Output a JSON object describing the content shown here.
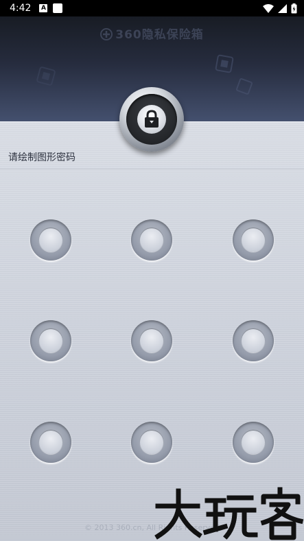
{
  "status_bar": {
    "time": "4:42",
    "notification_icon_letter": "A",
    "icons": [
      "a-notification-icon",
      "square-notification-icon",
      "wifi-icon",
      "signal-icon",
      "battery-icon"
    ]
  },
  "header": {
    "brand_text": "360隐私保险箱",
    "brand_icon": "plus-circle-icon"
  },
  "main": {
    "lock_icon": "padlock-icon",
    "hint_text": "请绘制图形密码",
    "pattern_dots": [
      {
        "row": 1,
        "col": 1
      },
      {
        "row": 1,
        "col": 2
      },
      {
        "row": 1,
        "col": 3
      },
      {
        "row": 2,
        "col": 1
      },
      {
        "row": 2,
        "col": 2
      },
      {
        "row": 2,
        "col": 3
      },
      {
        "row": 3,
        "col": 1
      },
      {
        "row": 3,
        "col": 2
      },
      {
        "row": 3,
        "col": 3
      }
    ]
  },
  "footer": {
    "copyright": "© 2013 360.cn, All Rights Reserved"
  },
  "watermark": {
    "text": "大玩客"
  },
  "colors": {
    "header_dark": "#181c24",
    "header_light": "#44506e",
    "metal": "#cdd2dc",
    "dot_ring": "#959cab"
  }
}
